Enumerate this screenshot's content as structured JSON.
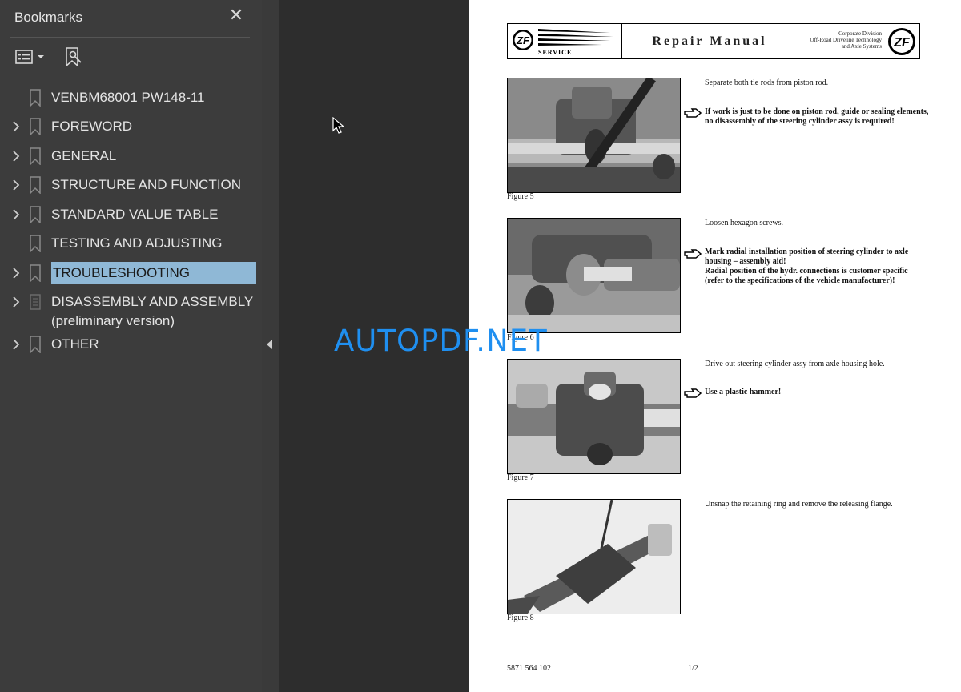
{
  "sidebar": {
    "title": "Bookmarks",
    "close_icon": "close-icon",
    "toolbar": {
      "options_icon": "list-options-icon",
      "bookmark_search_icon": "bookmark-search-icon"
    },
    "items": [
      {
        "label": "VENBM68001 PW148-11",
        "expandable": false
      },
      {
        "label": "FOREWORD",
        "expandable": true
      },
      {
        "label": "GENERAL",
        "expandable": true
      },
      {
        "label": "STRUCTURE AND FUNCTION",
        "expandable": true
      },
      {
        "label": "STANDARD VALUE TABLE",
        "expandable": true
      },
      {
        "label": "TESTING AND ADJUSTING",
        "expandable": false
      },
      {
        "label": "TROUBLESHOOTING",
        "expandable": true,
        "selected": true
      },
      {
        "label": "DISASSEMBLY AND ASSEMBLY",
        "label2": "(preliminary version)",
        "expandable": true
      },
      {
        "label": "OTHER",
        "expandable": true
      }
    ]
  },
  "document": {
    "header": {
      "logo_text": "ZF",
      "service": "SERVICE",
      "title": "Repair Manual",
      "corp_line1": "Corporate Division",
      "corp_line2": "Off-Road Driveline Technology",
      "corp_line3": "and Axle Systems"
    },
    "figures": [
      {
        "caption": "Figure 5",
        "text": "Separate both tie rods from piston rod.",
        "note": "If work is just to be done on piston rod, guide or sealing elements, no disassembly of the steering cylinder assy is required!"
      },
      {
        "caption": "Figure 6",
        "text": "Loosen hexagon screws.",
        "note": "Mark radial installation position of steering cylinder to axle housing – assembly aid!",
        "note2": "Radial position of the hydr. connections is customer specific (refer to the specifications of the vehicle manufacturer)!"
      },
      {
        "caption": "Figure 7",
        "text": "Drive out steering cylinder assy from axle housing hole.",
        "note": "Use a plastic hammer!"
      },
      {
        "caption": "Figure 8",
        "text": "Unsnap the retaining ring and remove the releasing flange."
      }
    ],
    "footer": {
      "doc_number": "5871 564 102",
      "page": "1/2"
    }
  },
  "watermark": "AUTOPDF.NET",
  "colors": {
    "sidebar_bg": "#3c3c3c",
    "selection": "#8fb8d6",
    "watermark": "#1f8ff0",
    "page_bg": "#ffffff"
  }
}
